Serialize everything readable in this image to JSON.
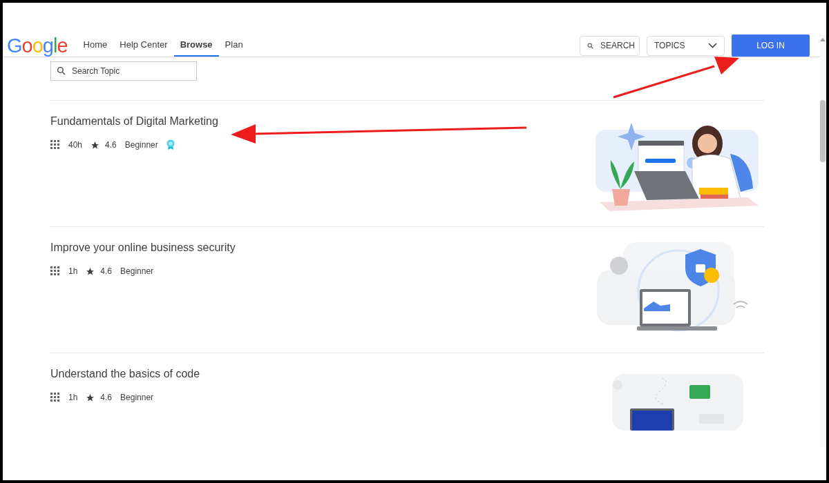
{
  "header": {
    "logo": "Google",
    "nav": [
      {
        "label": "Home",
        "selected": false
      },
      {
        "label": "Help Center",
        "selected": false
      },
      {
        "label": "Browse",
        "selected": true
      },
      {
        "label": "Plan",
        "selected": false
      }
    ],
    "search_button": "SEARCH",
    "topics_select": "TOPICS",
    "login_button": "LOG IN"
  },
  "search": {
    "placeholder": "Search Topic"
  },
  "courses": [
    {
      "title": "Fundamentals of Digital Marketing",
      "duration": "40h",
      "rating": "4.6",
      "level": "Beginner",
      "certificate": true,
      "kind": "marketing"
    },
    {
      "title": "Improve your online business security",
      "duration": "1h",
      "rating": "4.6",
      "level": "Beginner",
      "certificate": false,
      "kind": "security"
    },
    {
      "title": "Understand the basics of code",
      "duration": "1h",
      "rating": "4.6",
      "level": "Beginner",
      "certificate": false,
      "kind": "code"
    }
  ]
}
